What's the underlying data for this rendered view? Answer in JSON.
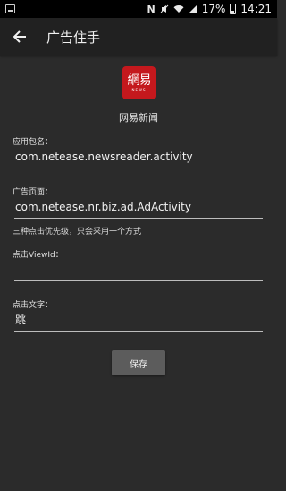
{
  "status_bar": {
    "battery_percent": "17%",
    "time": "14:21",
    "network_label": "N"
  },
  "toolbar": {
    "title": "广告住手"
  },
  "app": {
    "logo_text": "網易",
    "logo_subtext": "NEWS",
    "name": "网易新闻"
  },
  "form": {
    "package_label": "应用包名：",
    "package_value": "com.netease.newsreader.activity",
    "ad_page_label": "广告页面：",
    "ad_page_value": "com.netease.nr.biz.ad.AdActivity",
    "priority_hint": "三种点击优先级，只会采用一个方式",
    "viewid_label": "点击ViewId：",
    "viewid_value": "",
    "text_label": "点击文字：",
    "text_value": "跳",
    "save_label": "保存"
  }
}
